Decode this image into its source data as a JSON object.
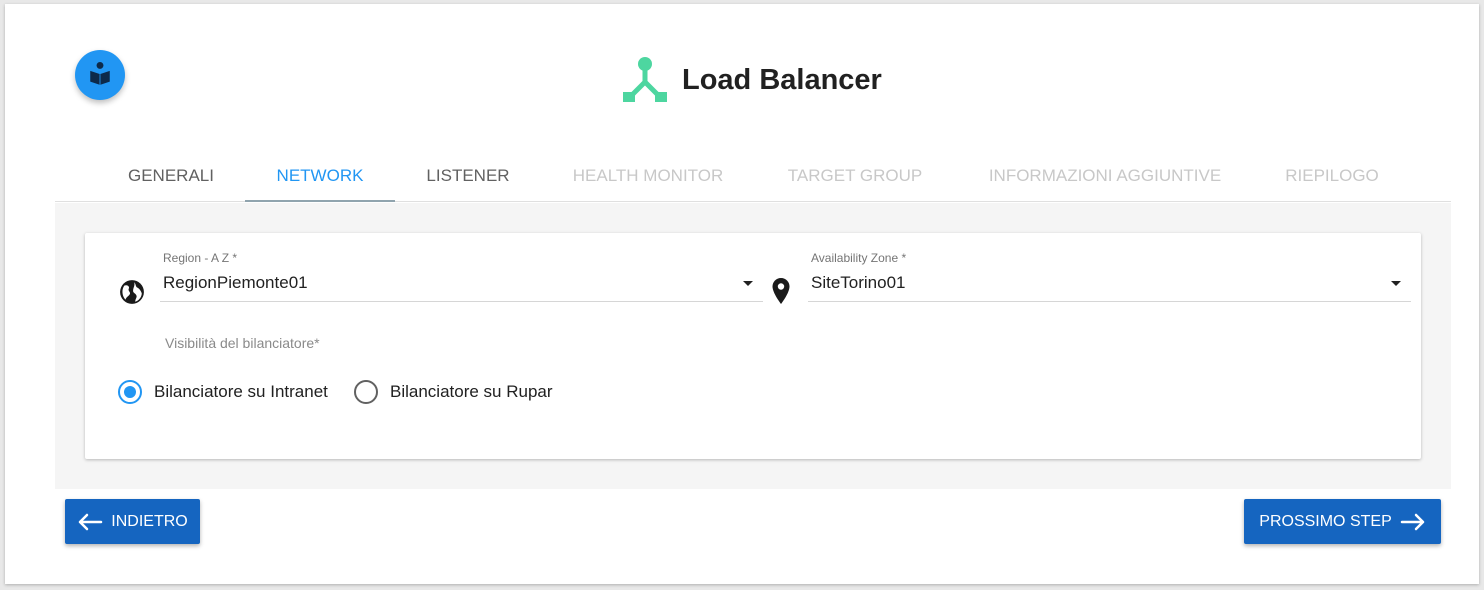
{
  "header": {
    "title": "Load Balancer",
    "help_icon": "book-reader-icon",
    "logo_icon": "load-balancer-icon",
    "logo_color": "#4dd6a0"
  },
  "tabs": [
    {
      "label": "GENERALI",
      "state": "enabled"
    },
    {
      "label": "NETWORK",
      "state": "active"
    },
    {
      "label": "LISTENER",
      "state": "enabled"
    },
    {
      "label": "HEALTH MONITOR",
      "state": "disabled"
    },
    {
      "label": "TARGET GROUP",
      "state": "disabled"
    },
    {
      "label": "INFORMAZIONI AGGIUNTIVE",
      "state": "disabled"
    },
    {
      "label": "RIEPILOGO",
      "state": "disabled"
    }
  ],
  "form": {
    "region": {
      "label": "Region - A Z *",
      "value": "RegionPiemonte01",
      "icon": "globe-icon"
    },
    "availability_zone": {
      "label": "Availability Zone *",
      "value": "SiteTorino01",
      "icon": "location-pin-icon"
    },
    "visibility_label": "Visibilità del bilanciatore*",
    "visibility_options": [
      {
        "label": "Bilanciatore su Intranet",
        "checked": true
      },
      {
        "label": "Bilanciatore su Rupar",
        "checked": false
      }
    ]
  },
  "footer": {
    "back_label": "INDIETRO",
    "next_label": "PROSSIMO STEP"
  },
  "colors": {
    "accent": "#2196f3",
    "button": "#1565c0",
    "disabled_tab": "#c8c8c8"
  }
}
